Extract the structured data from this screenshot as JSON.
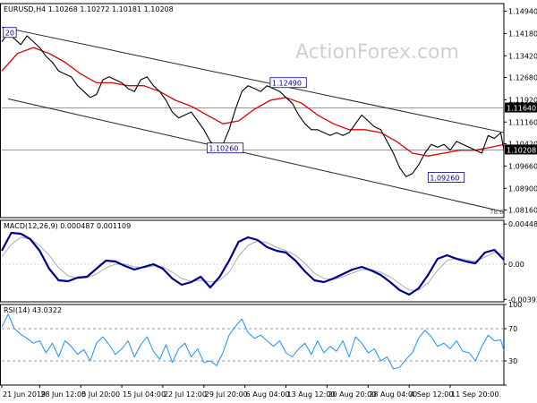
{
  "chart_data": {
    "type": "line",
    "main": {
      "title": "EURUSD,H4",
      "ohlc": {
        "open": "1.10268",
        "high": "1.10272",
        "low": "1.10181",
        "close": "1.10208"
      },
      "watermark": "ActionForex.com",
      "ylim": [
        1.079,
        1.152
      ],
      "yticks": [
        {
          "v": 1.1494,
          "label": "1.14940"
        },
        {
          "v": 1.1418,
          "label": "1.14180"
        },
        {
          "v": 1.1342,
          "label": "1.13420"
        },
        {
          "v": 1.1268,
          "label": "1.12680"
        },
        {
          "v": 1.1192,
          "label": "1.11920"
        },
        {
          "v": 1.1116,
          "label": "1.11160"
        },
        {
          "v": 1.1042,
          "label": "1.10420"
        },
        {
          "v": 1.0966,
          "label": "1.09660"
        },
        {
          "v": 1.089,
          "label": "1.08900"
        },
        {
          "v": 1.0816,
          "label": "1.08160"
        }
      ],
      "price_tags": [
        {
          "v": 1.1164,
          "label": "1.11640",
          "style": "dark"
        },
        {
          "v": 1.10208,
          "label": "1.10208",
          "style": "dark"
        }
      ],
      "hlines": [
        1.1164,
        1.10208
      ],
      "annotations": [
        {
          "label": "20",
          "x": 0.5,
          "v": 1.142
        },
        {
          "label": "1.12490",
          "x": 85,
          "v": 1.1249
        },
        {
          "label": "1.10260",
          "x": 65,
          "v": 1.1026
        },
        {
          "label": "1.09260",
          "x": 135,
          "v": 1.0926
        }
      ],
      "fib_label": "78.6",
      "channel_upper": [
        [
          0,
          1.144
        ],
        [
          159,
          1.108
        ]
      ],
      "channel_lower": [
        [
          2,
          1.1195
        ],
        [
          159,
          1.081
        ]
      ],
      "price": [
        [
          0,
          1.139
        ],
        [
          2,
          1.142
        ],
        [
          4,
          1.14
        ],
        [
          6,
          1.138
        ],
        [
          8,
          1.141
        ],
        [
          10,
          1.139
        ],
        [
          12,
          1.137
        ],
        [
          14,
          1.134
        ],
        [
          16,
          1.132
        ],
        [
          18,
          1.129
        ],
        [
          20,
          1.128
        ],
        [
          22,
          1.127
        ],
        [
          24,
          1.124
        ],
        [
          26,
          1.122
        ],
        [
          28,
          1.12
        ],
        [
          30,
          1.121
        ],
        [
          32,
          1.126
        ],
        [
          34,
          1.127
        ],
        [
          36,
          1.126
        ],
        [
          38,
          1.125
        ],
        [
          40,
          1.123
        ],
        [
          42,
          1.122
        ],
        [
          44,
          1.126
        ],
        [
          46,
          1.127
        ],
        [
          48,
          1.124
        ],
        [
          50,
          1.122
        ],
        [
          52,
          1.119
        ],
        [
          54,
          1.115
        ],
        [
          56,
          1.113
        ],
        [
          58,
          1.114
        ],
        [
          60,
          1.115
        ],
        [
          62,
          1.112
        ],
        [
          64,
          1.109
        ],
        [
          66,
          1.105
        ],
        [
          68,
          1.103
        ],
        [
          70,
          1.104
        ],
        [
          72,
          1.109
        ],
        [
          74,
          1.116
        ],
        [
          76,
          1.122
        ],
        [
          78,
          1.124
        ],
        [
          80,
          1.123
        ],
        [
          82,
          1.122
        ],
        [
          84,
          1.124
        ],
        [
          86,
          1.123
        ],
        [
          88,
          1.122
        ],
        [
          90,
          1.12
        ],
        [
          92,
          1.118
        ],
        [
          94,
          1.114
        ],
        [
          96,
          1.111
        ],
        [
          98,
          1.109
        ],
        [
          100,
          1.109
        ],
        [
          102,
          1.108
        ],
        [
          104,
          1.107
        ],
        [
          106,
          1.108
        ],
        [
          108,
          1.107
        ],
        [
          110,
          1.108
        ],
        [
          112,
          1.111
        ],
        [
          114,
          1.114
        ],
        [
          116,
          1.112
        ],
        [
          118,
          1.11
        ],
        [
          120,
          1.109
        ],
        [
          122,
          1.105
        ],
        [
          124,
          1.101
        ],
        [
          126,
          1.096
        ],
        [
          128,
          1.093
        ],
        [
          130,
          1.094
        ],
        [
          132,
          1.097
        ],
        [
          134,
          1.101
        ],
        [
          136,
          1.104
        ],
        [
          138,
          1.103
        ],
        [
          140,
          1.104
        ],
        [
          142,
          1.102
        ],
        [
          144,
          1.105
        ],
        [
          146,
          1.104
        ],
        [
          148,
          1.103
        ],
        [
          150,
          1.102
        ],
        [
          152,
          1.101
        ],
        [
          154,
          1.107
        ],
        [
          156,
          1.106
        ],
        [
          158,
          1.108
        ],
        [
          159,
          1.102
        ]
      ],
      "ma": [
        [
          0,
          1.129
        ],
        [
          5,
          1.135
        ],
        [
          10,
          1.137
        ],
        [
          15,
          1.135
        ],
        [
          20,
          1.132
        ],
        [
          25,
          1.128
        ],
        [
          30,
          1.125
        ],
        [
          35,
          1.125
        ],
        [
          40,
          1.124
        ],
        [
          45,
          1.124
        ],
        [
          50,
          1.122
        ],
        [
          55,
          1.119
        ],
        [
          60,
          1.117
        ],
        [
          65,
          1.114
        ],
        [
          70,
          1.111
        ],
        [
          75,
          1.112
        ],
        [
          80,
          1.116
        ],
        [
          85,
          1.119
        ],
        [
          90,
          1.12
        ],
        [
          95,
          1.118
        ],
        [
          100,
          1.114
        ],
        [
          105,
          1.111
        ],
        [
          110,
          1.109
        ],
        [
          115,
          1.109
        ],
        [
          120,
          1.108
        ],
        [
          125,
          1.105
        ],
        [
          130,
          1.101
        ],
        [
          135,
          1.1
        ],
        [
          140,
          1.101
        ],
        [
          145,
          1.102
        ],
        [
          150,
          1.102
        ],
        [
          155,
          1.103
        ],
        [
          159,
          1.104
        ]
      ]
    },
    "macd": {
      "title": "MACD(12,26,9) 0.000487 0.001109",
      "ylim": [
        -0.0042,
        0.0049
      ],
      "yticks": [
        {
          "v": 0.00448,
          "label": "0.00448"
        },
        {
          "v": 0.0,
          "label": "0.00"
        },
        {
          "v": -0.003928,
          "label": "-0.003928"
        }
      ],
      "line": [
        [
          0,
          0.0015
        ],
        [
          3,
          0.0035
        ],
        [
          6,
          0.0034
        ],
        [
          9,
          0.0028
        ],
        [
          12,
          0.0015
        ],
        [
          15,
          -0.0005
        ],
        [
          18,
          -0.0018
        ],
        [
          21,
          -0.0019
        ],
        [
          24,
          -0.0015
        ],
        [
          27,
          -0.0014
        ],
        [
          30,
          -0.0005
        ],
        [
          33,
          0.0004
        ],
        [
          36,
          0.0003
        ],
        [
          39,
          -0.0002
        ],
        [
          42,
          -0.0006
        ],
        [
          45,
          -0.0003
        ],
        [
          48,
          0.0
        ],
        [
          51,
          -0.0005
        ],
        [
          54,
          -0.0016
        ],
        [
          57,
          -0.0023
        ],
        [
          60,
          -0.002
        ],
        [
          63,
          -0.0014
        ],
        [
          66,
          -0.0026
        ],
        [
          69,
          -0.0014
        ],
        [
          72,
          0.0004
        ],
        [
          75,
          0.0025
        ],
        [
          78,
          0.003
        ],
        [
          81,
          0.0027
        ],
        [
          84,
          0.0019
        ],
        [
          87,
          0.0015
        ],
        [
          90,
          0.0013
        ],
        [
          93,
          0.0004
        ],
        [
          96,
          -0.0008
        ],
        [
          99,
          -0.0018
        ],
        [
          102,
          -0.002
        ],
        [
          105,
          -0.0016
        ],
        [
          108,
          -0.0011
        ],
        [
          111,
          -0.0006
        ],
        [
          114,
          -0.0003
        ],
        [
          117,
          -0.0007
        ],
        [
          120,
          -0.0012
        ],
        [
          123,
          -0.002
        ],
        [
          126,
          -0.0029
        ],
        [
          129,
          -0.0034
        ],
        [
          132,
          -0.0027
        ],
        [
          135,
          -0.0012
        ],
        [
          138,
          0.0006
        ],
        [
          141,
          0.001
        ],
        [
          144,
          0.0006
        ],
        [
          147,
          0.0003
        ],
        [
          150,
          0.0001
        ],
        [
          153,
          0.0013
        ],
        [
          156,
          0.0016
        ],
        [
          159,
          0.0005
        ]
      ],
      "signal": [
        [
          0,
          0.0008
        ],
        [
          3,
          0.0022
        ],
        [
          6,
          0.003
        ],
        [
          9,
          0.0028
        ],
        [
          12,
          0.0021
        ],
        [
          15,
          0.001
        ],
        [
          18,
          -0.0004
        ],
        [
          21,
          -0.0013
        ],
        [
          24,
          -0.0016
        ],
        [
          27,
          -0.0015
        ],
        [
          30,
          -0.0011
        ],
        [
          33,
          -0.0004
        ],
        [
          36,
          0.0
        ],
        [
          39,
          0.0
        ],
        [
          42,
          -0.0003
        ],
        [
          45,
          -0.0004
        ],
        [
          48,
          -0.0002
        ],
        [
          51,
          -0.0003
        ],
        [
          54,
          -0.0009
        ],
        [
          57,
          -0.0016
        ],
        [
          60,
          -0.0019
        ],
        [
          63,
          -0.0018
        ],
        [
          66,
          -0.002
        ],
        [
          69,
          -0.0018
        ],
        [
          72,
          -0.0009
        ],
        [
          75,
          0.0009
        ],
        [
          78,
          0.0021
        ],
        [
          81,
          0.0026
        ],
        [
          84,
          0.0024
        ],
        [
          87,
          0.0019
        ],
        [
          90,
          0.0015
        ],
        [
          93,
          0.001
        ],
        [
          96,
          0.0001
        ],
        [
          99,
          -0.001
        ],
        [
          102,
          -0.0016
        ],
        [
          105,
          -0.0017
        ],
        [
          108,
          -0.0014
        ],
        [
          111,
          -0.001
        ],
        [
          114,
          -0.0006
        ],
        [
          117,
          -0.0006
        ],
        [
          120,
          -0.0009
        ],
        [
          123,
          -0.0014
        ],
        [
          126,
          -0.0022
        ],
        [
          129,
          -0.0029
        ],
        [
          132,
          -0.0029
        ],
        [
          135,
          -0.0021
        ],
        [
          138,
          -0.0007
        ],
        [
          141,
          0.0004
        ],
        [
          144,
          0.0007
        ],
        [
          147,
          0.0005
        ],
        [
          150,
          0.0003
        ],
        [
          153,
          0.0008
        ],
        [
          156,
          0.0013
        ],
        [
          159,
          0.0011
        ]
      ]
    },
    "rsi": {
      "title": "RSI(14) 43.0322",
      "ylim": [
        0,
        100
      ],
      "yticks": [
        {
          "v": 100,
          "label": "100"
        },
        {
          "v": 70,
          "label": "70"
        },
        {
          "v": 30,
          "label": "30"
        },
        {
          "v": 0,
          "label": "0"
        }
      ],
      "levels": [
        70,
        30
      ],
      "values": [
        [
          0,
          72
        ],
        [
          2,
          88
        ],
        [
          4,
          70
        ],
        [
          6,
          63
        ],
        [
          8,
          58
        ],
        [
          10,
          52
        ],
        [
          12,
          55
        ],
        [
          14,
          40
        ],
        [
          16,
          52
        ],
        [
          18,
          35
        ],
        [
          20,
          55
        ],
        [
          22,
          48
        ],
        [
          24,
          38
        ],
        [
          26,
          44
        ],
        [
          28,
          30
        ],
        [
          30,
          52
        ],
        [
          32,
          60
        ],
        [
          34,
          50
        ],
        [
          36,
          38
        ],
        [
          38,
          45
        ],
        [
          40,
          55
        ],
        [
          42,
          35
        ],
        [
          44,
          50
        ],
        [
          46,
          60
        ],
        [
          48,
          42
        ],
        [
          50,
          32
        ],
        [
          52,
          50
        ],
        [
          54,
          28
        ],
        [
          56,
          45
        ],
        [
          58,
          52
        ],
        [
          60,
          35
        ],
        [
          62,
          45
        ],
        [
          64,
          28
        ],
        [
          66,
          30
        ],
        [
          68,
          24
        ],
        [
          70,
          40
        ],
        [
          72,
          62
        ],
        [
          74,
          73
        ],
        [
          76,
          82
        ],
        [
          78,
          65
        ],
        [
          80,
          58
        ],
        [
          82,
          62
        ],
        [
          84,
          55
        ],
        [
          86,
          48
        ],
        [
          88,
          55
        ],
        [
          90,
          40
        ],
        [
          92,
          35
        ],
        [
          94,
          45
        ],
        [
          96,
          52
        ],
        [
          98,
          38
        ],
        [
          100,
          55
        ],
        [
          102,
          40
        ],
        [
          104,
          48
        ],
        [
          106,
          42
        ],
        [
          108,
          55
        ],
        [
          110,
          35
        ],
        [
          112,
          60
        ],
        [
          114,
          52
        ],
        [
          116,
          40
        ],
        [
          118,
          45
        ],
        [
          120,
          30
        ],
        [
          122,
          35
        ],
        [
          124,
          20
        ],
        [
          126,
          22
        ],
        [
          128,
          32
        ],
        [
          130,
          40
        ],
        [
          132,
          58
        ],
        [
          134,
          68
        ],
        [
          136,
          60
        ],
        [
          138,
          48
        ],
        [
          140,
          52
        ],
        [
          142,
          45
        ],
        [
          144,
          55
        ],
        [
          146,
          42
        ],
        [
          148,
          40
        ],
        [
          150,
          30
        ],
        [
          152,
          48
        ],
        [
          154,
          62
        ],
        [
          156,
          55
        ],
        [
          158,
          56
        ],
        [
          159,
          43
        ]
      ]
    },
    "xticks": [
      {
        "i": 0,
        "label": "21 Jun 2019"
      },
      {
        "i": 12,
        "label": "28 Jun 12:00"
      },
      {
        "i": 25,
        "label": "5 Jul 20:00"
      },
      {
        "i": 38,
        "label": "15 Jul 04:00"
      },
      {
        "i": 51,
        "label": "22 Jul 12:00"
      },
      {
        "i": 64,
        "label": "29 Jul 20:00"
      },
      {
        "i": 77,
        "label": "6 Aug 04:00"
      },
      {
        "i": 90,
        "label": "13 Aug 12:00"
      },
      {
        "i": 103,
        "label": "20 Aug 20:00"
      },
      {
        "i": 116,
        "label": "28 Aug 04:00"
      },
      {
        "i": 129,
        "label": "4 Sep 12:00"
      },
      {
        "i": 142,
        "label": "11 Sep 20:00"
      }
    ],
    "colors": {
      "price": "#000000",
      "ma": "#e00000",
      "macd": "#00008b",
      "signal": "#aaaaaa",
      "rsi": "#1e90ff",
      "channel": "#222222",
      "grid": "#d8d8d8",
      "tag": "#000000"
    }
  }
}
